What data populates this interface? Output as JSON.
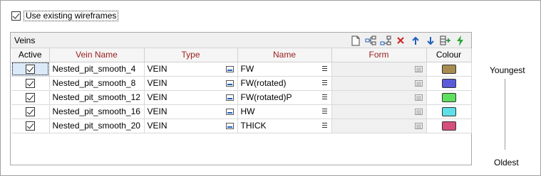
{
  "use_existing_wireframes": {
    "label": "Use existing wireframes",
    "checked": true
  },
  "veins_panel": {
    "title": "Veins",
    "toolbar": [
      "new-file-icon",
      "add-row-icon",
      "insert-row-icon",
      "delete-icon",
      "move-up-icon",
      "move-down-icon",
      "append-icon",
      "run-icon"
    ],
    "columns": {
      "active": "Active",
      "vein_name": "Vein Name",
      "type": "Type",
      "name": "Name",
      "form": "Form",
      "colour": "Colour"
    },
    "rows": [
      {
        "active": true,
        "vein_name": "Nested_pit_smooth_4",
        "type": "VEIN",
        "name": "FW",
        "form": "",
        "colour": "#a68c4f"
      },
      {
        "active": true,
        "vein_name": "Nested_pit_smooth_8",
        "type": "VEIN",
        "name": "FW(rotated)",
        "form": "",
        "colour": "#5b5bd9"
      },
      {
        "active": true,
        "vein_name": "Nested_pit_smooth_12",
        "type": "VEIN",
        "name": "FW(rotated)P",
        "form": "",
        "colour": "#5ee05e"
      },
      {
        "active": true,
        "vein_name": "Nested_pit_smooth_16",
        "type": "VEIN",
        "name": "HW",
        "form": "",
        "colour": "#5ee0e8"
      },
      {
        "active": true,
        "vein_name": "Nested_pit_smooth_20",
        "type": "VEIN",
        "name": "THICK",
        "form": "",
        "colour": "#d64f7b"
      }
    ]
  },
  "legend": {
    "top": "Youngest",
    "bottom": "Oldest"
  }
}
